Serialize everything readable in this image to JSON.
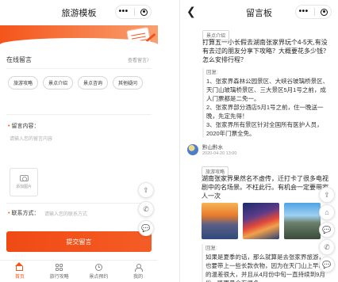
{
  "left": {
    "title": "旅游模板",
    "section_title": "在线留言",
    "section_link": "查看留言〉",
    "tags": [
      "旅游攻略",
      "景点介绍",
      "景点咨询",
      "其他疑问"
    ],
    "content_label": "留言内容：",
    "content_placeholder": "请输入您的留言内容",
    "upload_label": "添加图片",
    "contact_label": "联系方式：",
    "contact_placeholder": "请输入您的联系方式",
    "submit_label": "提交留言",
    "tabs": [
      {
        "label": "首页",
        "icon": "home-icon",
        "active": true
      },
      {
        "label": "旅行攻略",
        "icon": "grid-icon",
        "active": false
      },
      {
        "label": "景点预约",
        "icon": "clock-icon",
        "active": false
      },
      {
        "label": "我的",
        "icon": "user-icon",
        "active": false
      }
    ],
    "accent_color": "#f4541a"
  },
  "right": {
    "title": "留言板",
    "post1": {
      "tag": "景点介绍",
      "question": "打算五一小长假去湖南张家界玩个4-5天,有没有去过的朋友分享下攻略？大概要花多少钱？怎么安排行程？",
      "reply_label": "回复:",
      "reply_lines": [
        "1、张家界森林公园景区、大峡谷玻璃桥景区、天门山玻璃桥景区、三大景区5月1号之前，成人门票都是二免一。",
        "2、张家界部分酒店5月1号之前，住一晚送一晚，先定先得！",
        "3、张家界所有景区针对全国所有医护人员，2020年门票全免。"
      ]
    },
    "post2": {
      "user": "黔山黔水",
      "time": "2020-04-20 13:00",
      "tag": "旅游攻略",
      "text": "湖南张家界果然名不虚传，迁打卡了很多电视剧中的名场景。不枉此行。有机会一定要带家人一次",
      "reply_label": "回复:",
      "reply_text": "如果是夏季的话，那么就算是去张家界旅游，也要带上一些长款衣物，因为在天门山上早晚的温差很大，并且从4月份中旬一直持续到9月份，降雨量会有很多"
    }
  },
  "float_icons": [
    "share-icon",
    "phone-icon",
    "chat-icon",
    "home-icon"
  ]
}
